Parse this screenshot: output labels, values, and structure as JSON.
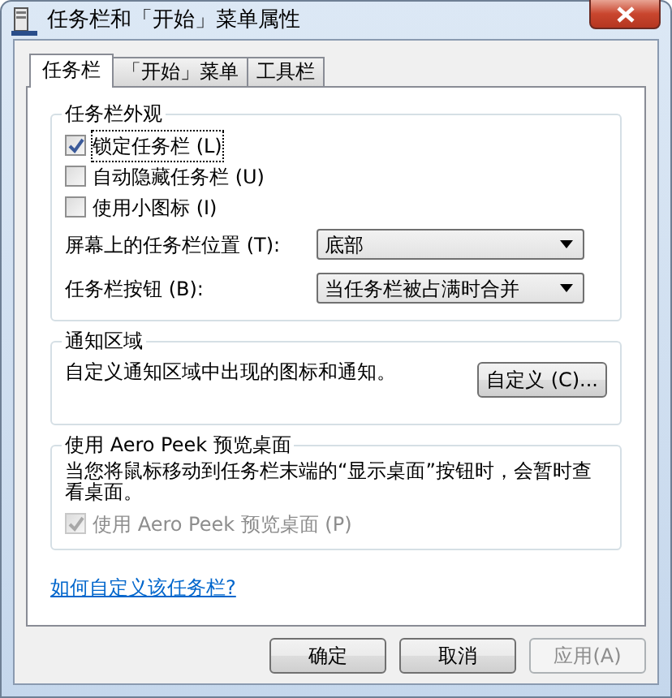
{
  "window": {
    "title": "任务栏和「开始」菜单属性"
  },
  "tabs": [
    {
      "label": "任务栏",
      "selected": true
    },
    {
      "label": "「开始」菜单",
      "selected": false
    },
    {
      "label": "工具栏",
      "selected": false
    }
  ],
  "appearance": {
    "title": "任务栏外观",
    "checkboxes": [
      {
        "label": "锁定任务栏 (L)",
        "checked": true,
        "focused": true
      },
      {
        "label": "自动隐藏任务栏 (U)",
        "checked": false,
        "focused": false
      },
      {
        "label": "使用小图标 (I)",
        "checked": false,
        "focused": false
      }
    ],
    "selects": [
      {
        "label": "屏幕上的任务栏位置 (T):",
        "value": "底部"
      },
      {
        "label": "任务栏按钮 (B):",
        "value": "当任务栏被占满时合并"
      }
    ]
  },
  "notification_area": {
    "title": "通知区域",
    "text": "自定义通知区域中出现的图标和通知。",
    "button": "自定义 (C)..."
  },
  "aero_peek": {
    "title": "使用 Aero Peek 预览桌面",
    "text": "当您将鼠标移动到任务栏末端的“显示桌面”按钮时，会暂时查看桌面。",
    "checkbox": {
      "label": "使用 Aero Peek 预览桌面 (P)",
      "checked": true,
      "disabled": true
    }
  },
  "help_link": "如何自定义该任务栏?",
  "buttons": [
    {
      "label": "确定",
      "disabled": false
    },
    {
      "label": "取消",
      "disabled": false
    },
    {
      "label": "应用(A)",
      "disabled": true
    }
  ]
}
